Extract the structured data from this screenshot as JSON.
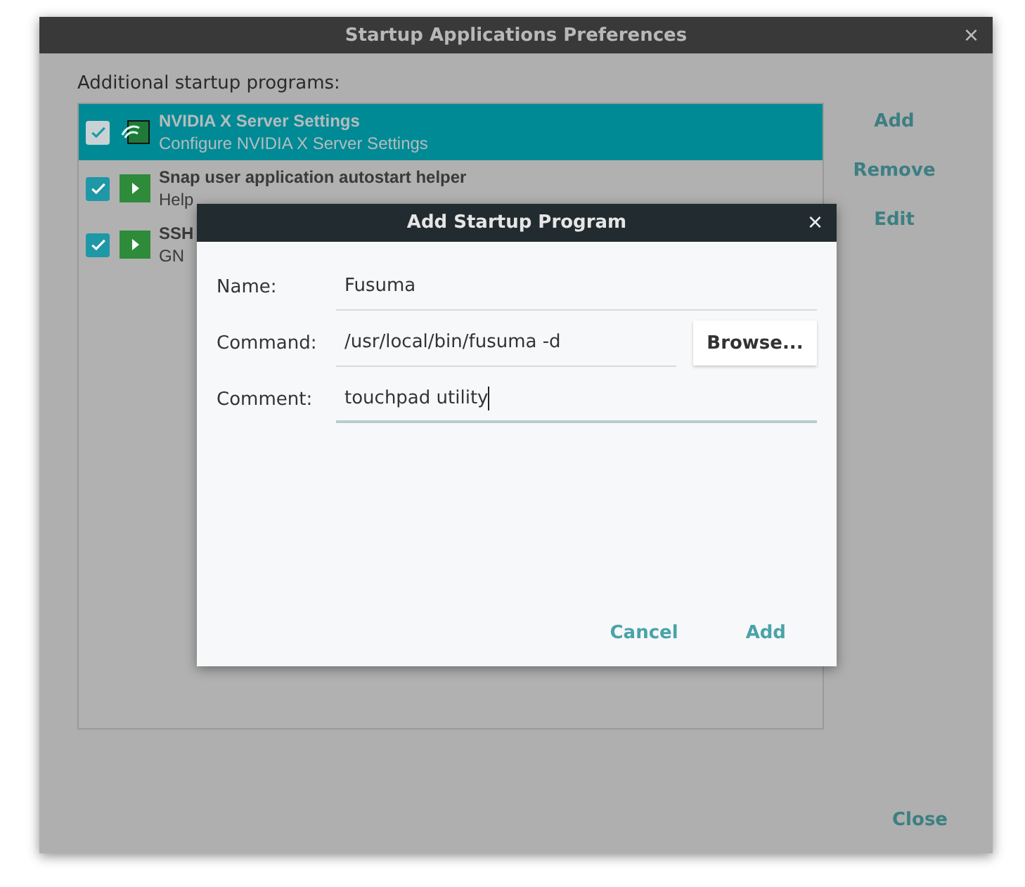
{
  "window": {
    "title": "Startup Applications Preferences",
    "close": "×"
  },
  "list_label": "Additional startup programs:",
  "programs": [
    {
      "name": "NVIDIA X Server Settings",
      "comment": "Configure NVIDIA X Server Settings",
      "checked": true,
      "selected": true,
      "kind": "nvidia"
    },
    {
      "name": "Snap user application autostart helper",
      "comment": "Help",
      "checked": true,
      "selected": false,
      "kind": "play"
    },
    {
      "name": "SSH",
      "comment": "GN",
      "checked": true,
      "selected": false,
      "kind": "play"
    }
  ],
  "side_buttons": [
    "Add",
    "Remove",
    "Edit"
  ],
  "close_button": "Close",
  "dialog": {
    "title": "Add Startup Program",
    "close": "×",
    "fields": [
      {
        "label": "Name:",
        "value": "Fusuma",
        "focused": false
      },
      {
        "label": "Command:",
        "value": "/usr/local/bin/fusuma -d",
        "focused": false,
        "browse": "Browse..."
      },
      {
        "label": "Comment:",
        "value": "touchpad utility",
        "focused": true
      }
    ],
    "cancel": "Cancel",
    "ok": "Add"
  }
}
